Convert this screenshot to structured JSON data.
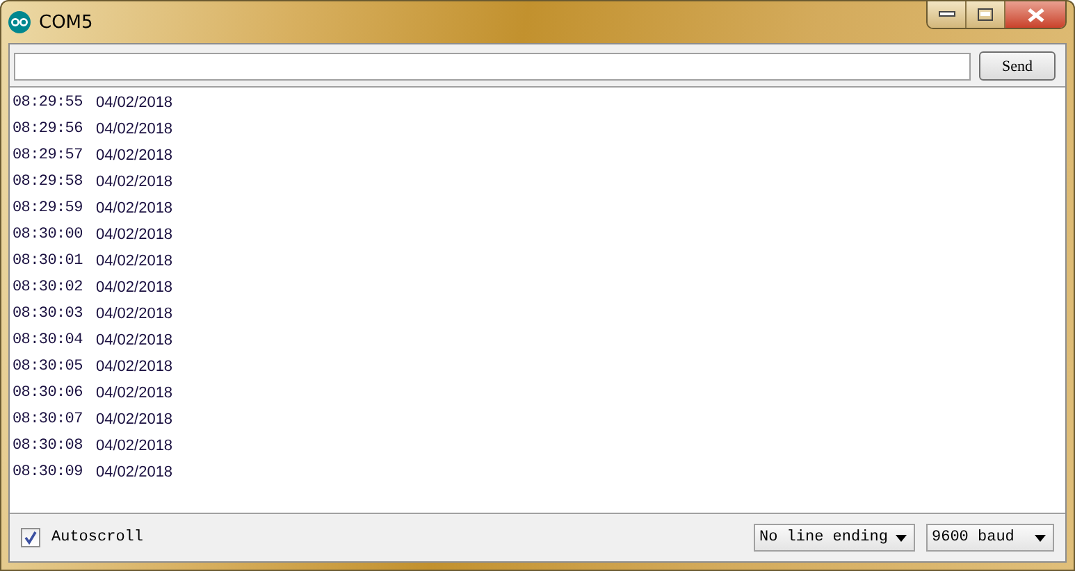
{
  "window": {
    "title": "COM5"
  },
  "send_button": "Send",
  "lines": [
    {
      "time": "08:29:55",
      "date": "04/02/2018"
    },
    {
      "time": "08:29:56",
      "date": "04/02/2018"
    },
    {
      "time": "08:29:57",
      "date": "04/02/2018"
    },
    {
      "time": "08:29:58",
      "date": "04/02/2018"
    },
    {
      "time": "08:29:59",
      "date": "04/02/2018"
    },
    {
      "time": "08:30:00",
      "date": "04/02/2018"
    },
    {
      "time": "08:30:01",
      "date": "04/02/2018"
    },
    {
      "time": "08:30:02",
      "date": "04/02/2018"
    },
    {
      "time": "08:30:03",
      "date": "04/02/2018"
    },
    {
      "time": "08:30:04",
      "date": "04/02/2018"
    },
    {
      "time": "08:30:05",
      "date": "04/02/2018"
    },
    {
      "time": "08:30:06",
      "date": "04/02/2018"
    },
    {
      "time": "08:30:07",
      "date": "04/02/2018"
    },
    {
      "time": "08:30:08",
      "date": "04/02/2018"
    },
    {
      "time": "08:30:09",
      "date": "04/02/2018"
    }
  ],
  "autoscroll": {
    "label": "Autoscroll",
    "checked": true
  },
  "line_ending": "No line ending",
  "baud": "9600 baud"
}
